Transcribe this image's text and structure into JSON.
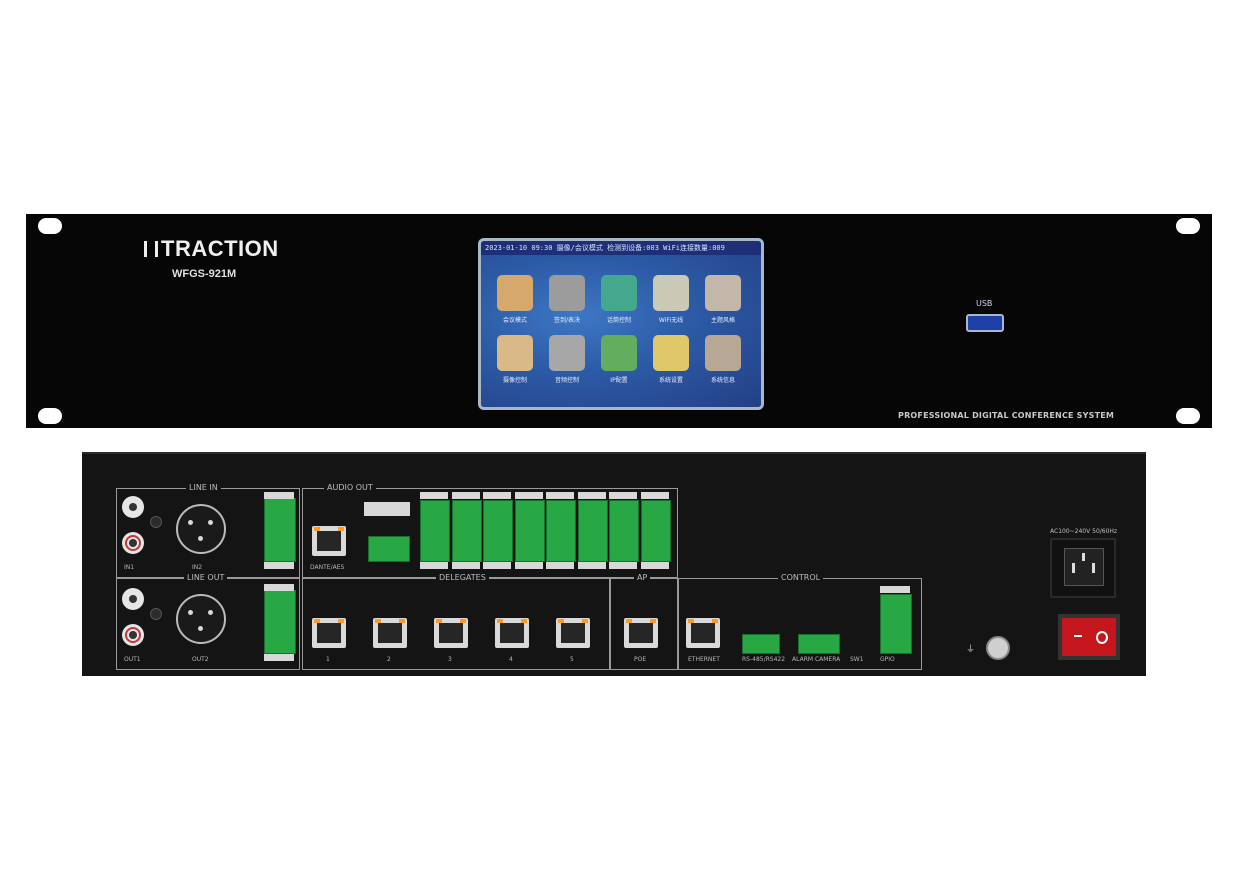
{
  "front_panel": {
    "brand": "TRACTION",
    "model": "WFGS-921M",
    "usb_label": "USB",
    "tagline": "PROFESSIONAL DIGITAL CONFERENCE SYSTEM",
    "screen": {
      "status_bar": "2023-01-10  09:30   摄像/会议模式   检测到设备:003   WiFi连接数量:009",
      "apps_row1": [
        {
          "label": "会议模式",
          "icon": "microphone-icon",
          "color": "#d7a86b"
        },
        {
          "label": "签到/表决",
          "icon": "chart-icon",
          "color": "#9c9c9c"
        },
        {
          "label": "话筒控制",
          "icon": "mic-stand-icon",
          "color": "#43a88c"
        },
        {
          "label": "WiFi无线",
          "icon": "dish-icon",
          "color": "#c9c9b6"
        },
        {
          "label": "主题风格",
          "icon": "brush-icon",
          "color": "#c2b7a8"
        }
      ],
      "apps_row2": [
        {
          "label": "摄像控制",
          "icon": "camera-icon",
          "color": "#d8b987"
        },
        {
          "label": "音频控制",
          "icon": "waveform-icon",
          "color": "#a7a7a7"
        },
        {
          "label": "IP配置",
          "icon": "ip-icon",
          "color": "#62ae5e"
        },
        {
          "label": "系统设置",
          "icon": "gear-icon",
          "color": "#e0c76a"
        },
        {
          "label": "系统信息",
          "icon": "info-book-icon",
          "color": "#b7a896"
        }
      ]
    }
  },
  "rear_panel": {
    "line_in_title": "LINE IN",
    "audio_out_title": "AUDIO OUT",
    "line_out_title": "LINE OUT",
    "delegates_title": "DELEGATES",
    "ap_title": "AP",
    "control_title": "CONTROL",
    "delegate_ports": [
      "1",
      "2",
      "3",
      "4",
      "5"
    ],
    "ap_port_label": "POE",
    "ethernet_label": "ETHERNET",
    "dante_label": "DANTE/AES",
    "power_label": "AC100~240V 50/60Hz",
    "labels": {
      "in1": "IN1",
      "in2": "IN2",
      "out1": "OUT1",
      "out2": "OUT2",
      "rs485": "RS-485/RS422",
      "alarm": "ALARM CAMERA",
      "sw1": "SW1",
      "gpio": "GPIO"
    }
  }
}
